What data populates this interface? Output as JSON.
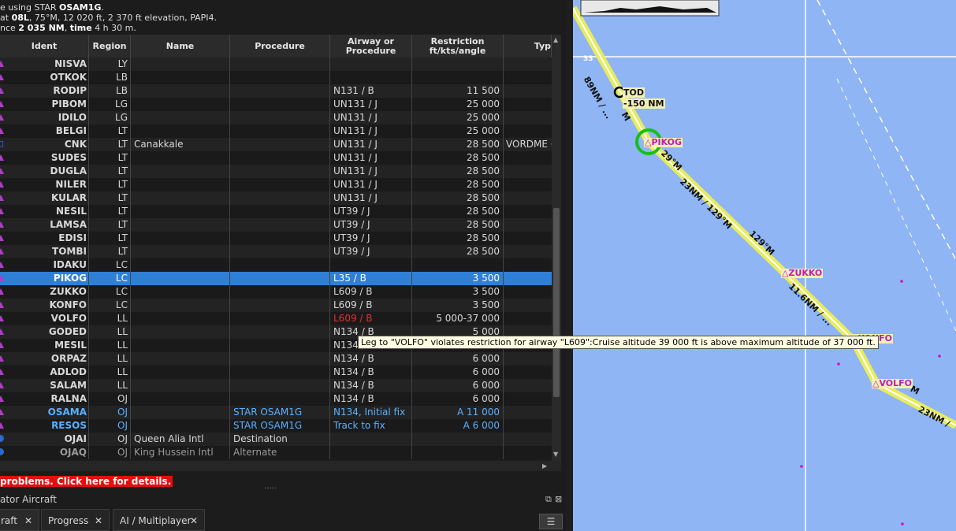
{
  "header": {
    "line2_prefix": "e using STAR ",
    "line2_star": "OSAM1G",
    "line2_suffix": ".",
    "line3_prefix": "at ",
    "line3_rwy": "08L",
    "line3_rest": ", 75°M, 12 020 ft, 2 370 ft elevation, PAPI4.",
    "line4_prefix": "nce ",
    "line4_dist": "2 035 NM",
    "line4_mid": ", ",
    "line4_time_label": "time",
    "line4_time": " 4 h 30 m."
  },
  "columns": {
    "ident": "Ident",
    "region": "Region",
    "name": "Name",
    "procedure": "Procedure",
    "airway_l1": "Airway or",
    "airway_l2": "Procedure",
    "restr_l1": "Restriction",
    "restr_l2": "ft/kts/angle",
    "type": "Typ"
  },
  "rows": [
    {
      "icon": "tri",
      "ident": "NISVA",
      "region": "LY",
      "name": "",
      "procedure": "",
      "airway": "",
      "restriction": "",
      "type": ""
    },
    {
      "icon": "tri",
      "ident": "OTKOK",
      "region": "LB",
      "name": "",
      "procedure": "",
      "airway": "",
      "restriction": "",
      "type": ""
    },
    {
      "icon": "tri",
      "ident": "RODIP",
      "region": "LB",
      "name": "",
      "procedure": "",
      "airway": "N131 / B",
      "restriction": "11 500",
      "type": ""
    },
    {
      "icon": "tri",
      "ident": "PIBOM",
      "region": "LG",
      "name": "",
      "procedure": "",
      "airway": "UN131 / J",
      "restriction": "25 000",
      "type": ""
    },
    {
      "icon": "tri",
      "ident": "IDILO",
      "region": "LG",
      "name": "",
      "procedure": "",
      "airway": "UN131 / J",
      "restriction": "25 000",
      "type": ""
    },
    {
      "icon": "tri",
      "ident": "BELGI",
      "region": "LT",
      "name": "",
      "procedure": "",
      "airway": "UN131 / J",
      "restriction": "25 000",
      "type": ""
    },
    {
      "icon": "sq",
      "ident": "CNK",
      "region": "LT",
      "name": "Canakkale",
      "procedure": "",
      "airway": "UN131 / J",
      "restriction": "28 500",
      "type": "VORDME ("
    },
    {
      "icon": "tri",
      "ident": "SUDES",
      "region": "LT",
      "name": "",
      "procedure": "",
      "airway": "UN131 / J",
      "restriction": "28 500",
      "type": ""
    },
    {
      "icon": "tri",
      "ident": "DUGLA",
      "region": "LT",
      "name": "",
      "procedure": "",
      "airway": "UN131 / J",
      "restriction": "28 500",
      "type": ""
    },
    {
      "icon": "tri",
      "ident": "NILER",
      "region": "LT",
      "name": "",
      "procedure": "",
      "airway": "UN131 / J",
      "restriction": "28 500",
      "type": ""
    },
    {
      "icon": "tri",
      "ident": "KULAR",
      "region": "LT",
      "name": "",
      "procedure": "",
      "airway": "UN131 / J",
      "restriction": "28 500",
      "type": ""
    },
    {
      "icon": "tri",
      "ident": "NESIL",
      "region": "LT",
      "name": "",
      "procedure": "",
      "airway": "UT39 / J",
      "restriction": "28 500",
      "type": ""
    },
    {
      "icon": "tri",
      "ident": "LAMSA",
      "region": "LT",
      "name": "",
      "procedure": "",
      "airway": "UT39 / J",
      "restriction": "28 500",
      "type": ""
    },
    {
      "icon": "tri",
      "ident": "EDISI",
      "region": "LT",
      "name": "",
      "procedure": "",
      "airway": "UT39 / J",
      "restriction": "28 500",
      "type": ""
    },
    {
      "icon": "tri",
      "ident": "TOMBI",
      "region": "LT",
      "name": "",
      "procedure": "",
      "airway": "UT39 / J",
      "restriction": "28 500",
      "type": ""
    },
    {
      "icon": "tri",
      "ident": "IDAKU",
      "region": "LC",
      "name": "",
      "procedure": "",
      "airway": "",
      "restriction": "",
      "type": ""
    },
    {
      "icon": "tri",
      "ident": "PIKOG",
      "region": "LC",
      "name": "",
      "procedure": "",
      "airway": "L35 / B",
      "restriction": "3 500",
      "type": "",
      "selected": true
    },
    {
      "icon": "tri",
      "ident": "ZUKKO",
      "region": "LC",
      "name": "",
      "procedure": "",
      "airway": "L609 / B",
      "restriction": "3 500",
      "type": ""
    },
    {
      "icon": "tri",
      "ident": "KONFO",
      "region": "LC",
      "name": "",
      "procedure": "",
      "airway": "L609 / B",
      "restriction": "3 500",
      "type": ""
    },
    {
      "icon": "tri",
      "ident": "VOLFO",
      "region": "LL",
      "name": "",
      "procedure": "",
      "airway": "L609 / B",
      "restriction": "5 000-37 000",
      "type": "",
      "error": true
    },
    {
      "icon": "tri",
      "ident": "GODED",
      "region": "LL",
      "name": "",
      "procedure": "",
      "airway": "N134 / B",
      "restriction": "5 000",
      "type": ""
    },
    {
      "icon": "tri",
      "ident": "MESIL",
      "region": "LL",
      "name": "",
      "procedure": "",
      "airway": "N134 / B",
      "restriction": "",
      "type": ""
    },
    {
      "icon": "tri",
      "ident": "ORPAZ",
      "region": "LL",
      "name": "",
      "procedure": "",
      "airway": "N134 / B",
      "restriction": "6 000",
      "type": ""
    },
    {
      "icon": "tri",
      "ident": "ADLOD",
      "region": "LL",
      "name": "",
      "procedure": "",
      "airway": "N134 / B",
      "restriction": "6 000",
      "type": ""
    },
    {
      "icon": "tri",
      "ident": "SALAM",
      "region": "LL",
      "name": "",
      "procedure": "",
      "airway": "N134 / B",
      "restriction": "6 000",
      "type": ""
    },
    {
      "icon": "tri",
      "ident": "RALNA",
      "region": "OJ",
      "name": "",
      "procedure": "",
      "airway": "N134 / B",
      "restriction": "6 000",
      "type": ""
    },
    {
      "icon": "tri",
      "ident": "OSAMA",
      "region": "OJ",
      "name": "",
      "procedure": "STAR OSAM1G",
      "airway": "N134, Initial fix",
      "restriction": "A 11 000",
      "type": "",
      "star": true
    },
    {
      "icon": "tri",
      "ident": "RESOS",
      "region": "OJ",
      "name": "",
      "procedure": "STAR OSAM1G",
      "airway": "Track to fix",
      "restriction": "A 6 000",
      "type": "",
      "star": true
    },
    {
      "icon": "ap",
      "ident": "OJAI",
      "region": "OJ",
      "name": "Queen Alia Intl",
      "procedure": "Destination",
      "airway": "",
      "restriction": "",
      "type": ""
    },
    {
      "icon": "ap",
      "ident": "OJAQ",
      "region": "OJ",
      "name": "King Hussein Intl",
      "procedure": "Alternate",
      "airway": "",
      "restriction": "",
      "type": "",
      "alt": true
    }
  ],
  "tooltip": "Leg to \"VOLFO\" violates restriction for airway \"L609\":Cruise altitude 39 000 ft is above maximum altitude of 37 000 ft.",
  "error_bar": " problems. Click here for details.",
  "dock_title": "ator Aircraft",
  "tabs": [
    {
      "label": "raft"
    },
    {
      "label": "Progress"
    },
    {
      "label": "AI / Multiplayer"
    }
  ],
  "map": {
    "waypoints": [
      "PIKOG",
      "ZUKKO",
      "KONFO",
      "VOLFO"
    ],
    "top_labels": {
      "tod": "TOD",
      "dist": "-150 NM"
    },
    "leg_labels": [
      "89NM / ...",
      "23NM / 129°M",
      "129°M",
      "11.6NM / ...",
      "23NM /",
      "29°M",
      "M",
      "M",
      "33"
    ]
  },
  "colors": {
    "selection": "#2f7fd6",
    "route": "#e8ec5c",
    "waypoint": "#c21bb5",
    "map_bg": "#8fb5f5",
    "error": "#e01010"
  }
}
